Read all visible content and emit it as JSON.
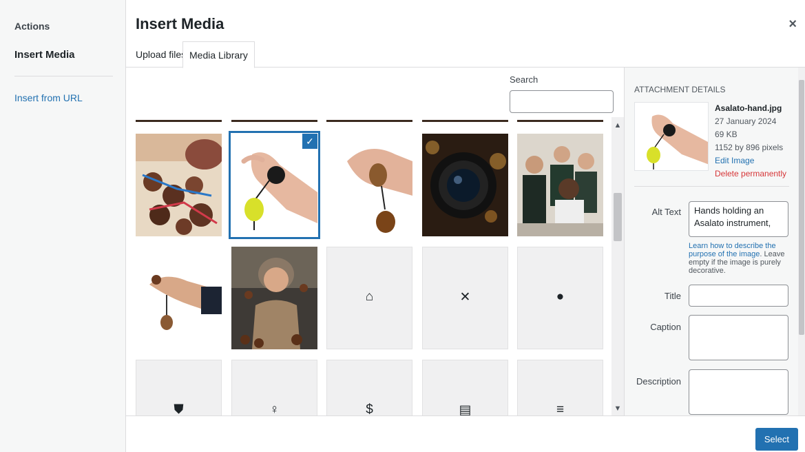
{
  "sidebar": {
    "heading": "Actions",
    "active_item": "Insert Media",
    "link": "Insert from URL"
  },
  "modal": {
    "title": "Insert Media",
    "close_glyph": "×"
  },
  "tabs": [
    "Upload files",
    "Media Library"
  ],
  "search": {
    "label": "Search",
    "value": ""
  },
  "grid": {
    "check_glyph": "✓",
    "items": [
      {
        "kind": "image",
        "name": "beach-asalato-balls"
      },
      {
        "kind": "image",
        "name": "asalato-hand",
        "selected": true
      },
      {
        "kind": "image",
        "name": "asalato-brown-hand"
      },
      {
        "kind": "image",
        "name": "camera-lens"
      },
      {
        "kind": "image",
        "name": "team-at-laptop"
      },
      {
        "kind": "image",
        "name": "asalato-dangling-hand"
      },
      {
        "kind": "image",
        "name": "woman-playing-asalato"
      },
      {
        "kind": "icon",
        "name": "home-icon",
        "glyph": "⌂"
      },
      {
        "kind": "icon",
        "name": "close-icon",
        "glyph": "✕"
      },
      {
        "kind": "icon",
        "name": "alert-icon",
        "glyph": "●"
      },
      {
        "kind": "icon",
        "name": "shield-icon",
        "glyph": "⛊"
      },
      {
        "kind": "icon",
        "name": "user-icon",
        "glyph": "♀"
      },
      {
        "kind": "icon",
        "name": "dollar-icon",
        "glyph": "$"
      },
      {
        "kind": "icon",
        "name": "calendar-icon",
        "glyph": "▤"
      },
      {
        "kind": "icon",
        "name": "menu-icon",
        "glyph": "≡"
      }
    ]
  },
  "details": {
    "heading": "ATTACHMENT DETAILS",
    "filename": "Asalato-hand.jpg",
    "date": "27 January 2024",
    "size": "69 KB",
    "dimensions": "1152 by 896 pixels",
    "edit_link": "Edit Image",
    "delete_link": "Delete permanently",
    "alt_label": "Alt Text",
    "alt_value": "Hands holding an Asalato instrument,",
    "alt_note_link": "Learn how to describe the purpose of the image",
    "alt_note_rest": ". Leave empty if the image is purely decorative.",
    "title_label": "Title",
    "caption_label": "Caption",
    "description_label": "Description"
  },
  "footer": {
    "select_label": "Select"
  },
  "colors": {
    "accent": "#2271b1",
    "danger": "#d63638"
  }
}
